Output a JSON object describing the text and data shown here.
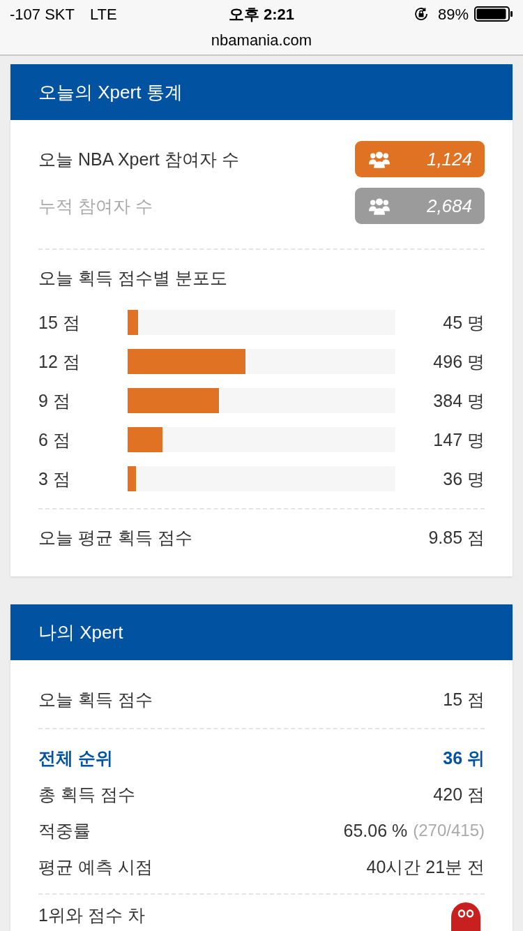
{
  "status_bar": {
    "carrier": "-107 SKT",
    "network": "LTE",
    "time": "오후 2:21",
    "battery": "89%"
  },
  "address_bar": {
    "url": "nbamania.com"
  },
  "stats_card": {
    "title": "오늘의 Xpert 통계",
    "participants": [
      {
        "kind": "today",
        "label": "오늘 NBA Xpert 참여자 수",
        "count": "1,124"
      },
      {
        "kind": "total",
        "label": "누적 참여자 수",
        "count": "2,684"
      }
    ],
    "distribution_title": "오늘 획득 점수별 분포도",
    "distribution": [
      {
        "score": "15 점",
        "level": 0.04,
        "count": "45 명"
      },
      {
        "score": "12 점",
        "level": 0.441,
        "count": "496 명"
      },
      {
        "score": "9 점",
        "level": 0.342,
        "count": "384 명"
      },
      {
        "score": "6 점",
        "level": 0.131,
        "count": "147 명"
      },
      {
        "score": "3 점",
        "level": 0.032,
        "count": "36 명"
      }
    ],
    "average": {
      "label": "오늘 평균 획득 점수",
      "value": "9.85 점"
    }
  },
  "my_card": {
    "title": "나의 Xpert",
    "today": {
      "label": "오늘 획득 점수",
      "value": "15 점"
    },
    "rows": [
      {
        "label": "전체 순위",
        "value": "36 위",
        "highlight": true
      },
      {
        "label": "총 획득 점수",
        "value": "420 점",
        "highlight": false
      },
      {
        "label": "적중률",
        "value": "65.06 %",
        "detail": "(270/415)",
        "highlight": false
      },
      {
        "label": "평균 예측 시점",
        "value": "40시간 21분 전",
        "highlight": false
      }
    ],
    "gap_row": {
      "label": "1위와 점수 차"
    }
  }
}
